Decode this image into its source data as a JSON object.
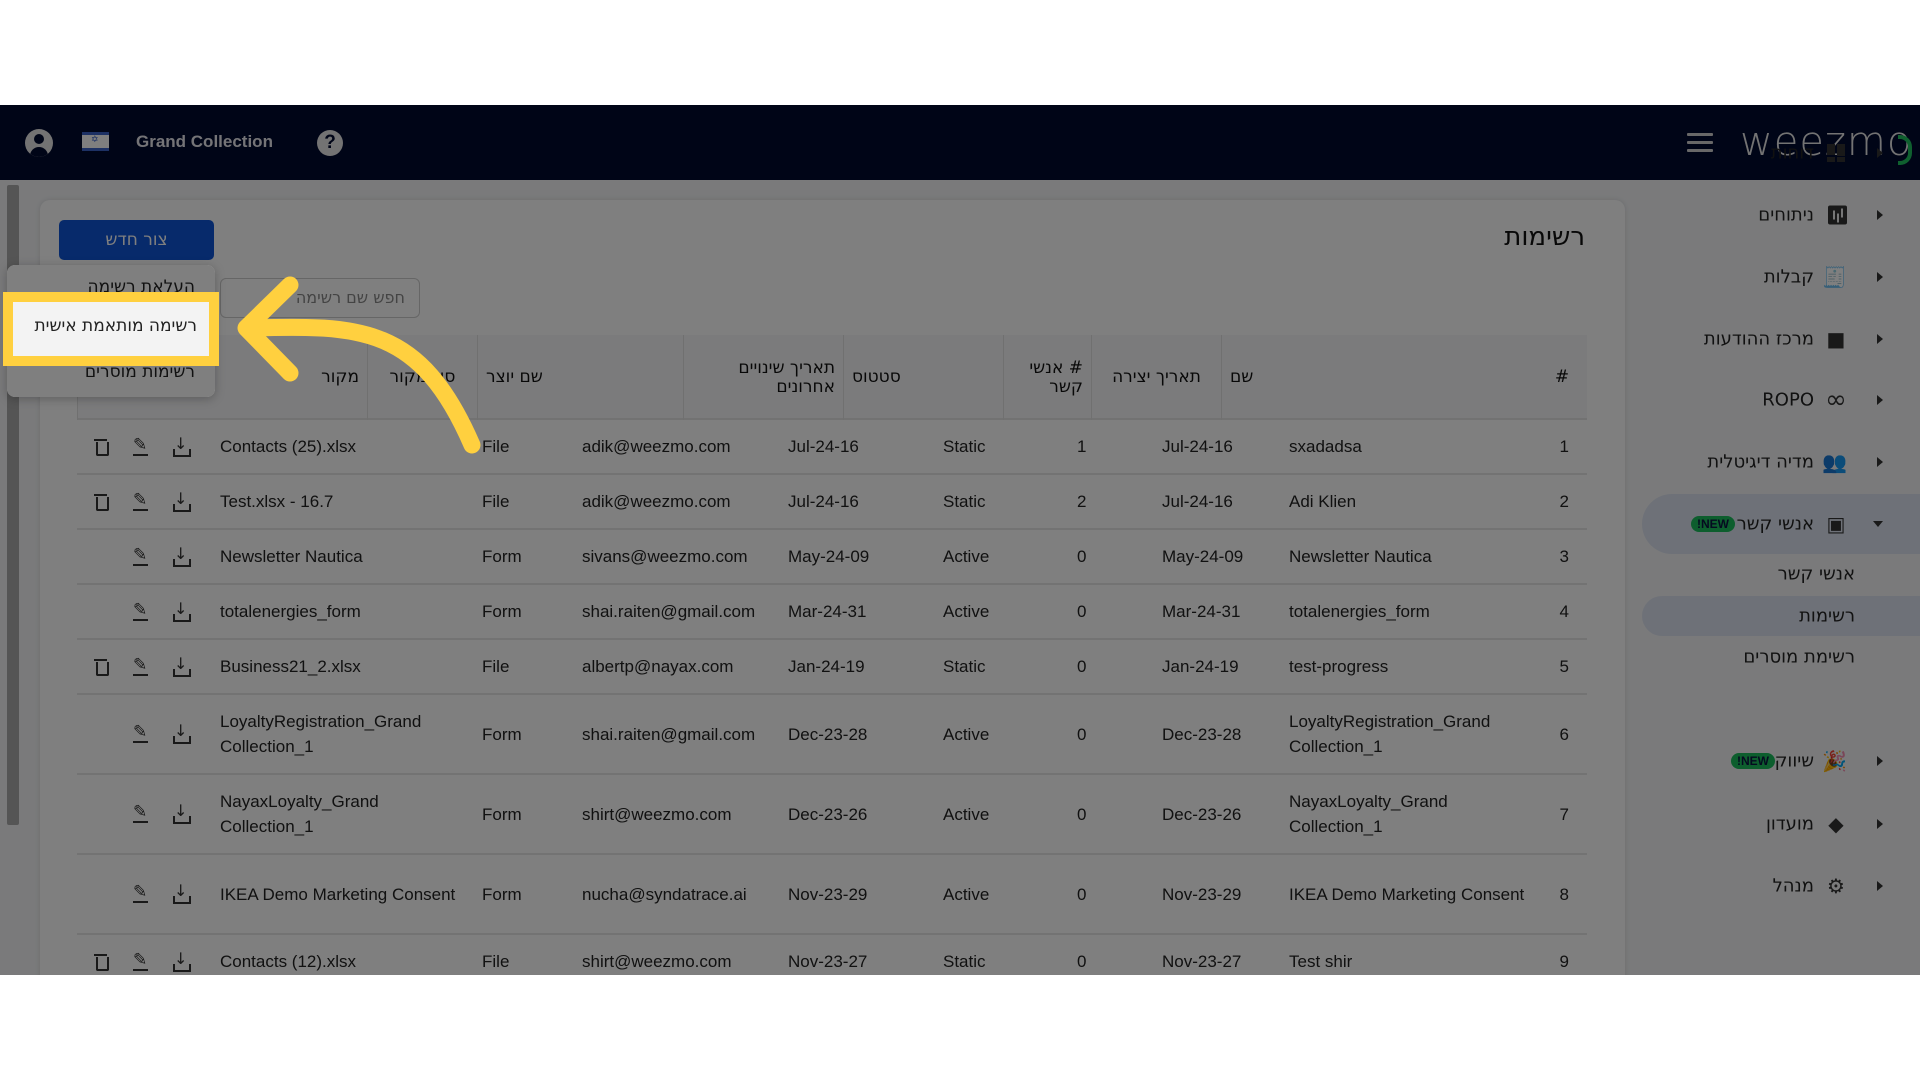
{
  "header": {
    "account_name": "Grand Collection",
    "logo_text": "weezmo",
    "icons": [
      "user-icon",
      "israel-flag-icon",
      "help-icon",
      "menu-icon"
    ]
  },
  "page": {
    "title": "רשימות",
    "create_button": "צור חדש",
    "search_placeholder": "חפש שם רשימה"
  },
  "dropdown": {
    "items": [
      "העלאת רשימה",
      "רשימה מותאמת אישית",
      "רשימות מוסרים"
    ],
    "highlighted_index": 1
  },
  "table": {
    "columns": [
      "#",
      "שם",
      "תאריך יצירה",
      "# אנשי קשר",
      "סטטוס",
      "תאריך שינויים אחרונים",
      "שם יוצר",
      "סוג מקור",
      "מקור"
    ],
    "rows": [
      {
        "num": "1",
        "name": "sxadadsa",
        "created": "Jul-24-16",
        "contacts": "1",
        "status": "Static",
        "modified": "Jul-24-16",
        "creator": "adik@weezmo.com",
        "source_type": "File",
        "source": "Contacts (25).xlsx",
        "deletable": true
      },
      {
        "num": "2",
        "name": "Adi Klien",
        "created": "Jul-24-16",
        "contacts": "2",
        "status": "Static",
        "modified": "Jul-24-16",
        "creator": "adik@weezmo.com",
        "source_type": "File",
        "source": "Test.xlsx - 16.7",
        "deletable": true
      },
      {
        "num": "3",
        "name": "Newsletter Nautica",
        "created": "May-24-09",
        "contacts": "0",
        "status": "Active",
        "modified": "May-24-09",
        "creator": "sivans@weezmo.com",
        "source_type": "Form",
        "source": "Newsletter Nautica",
        "deletable": false
      },
      {
        "num": "4",
        "name": "totalenergies_form",
        "created": "Mar-24-31",
        "contacts": "0",
        "status": "Active",
        "modified": "Mar-24-31",
        "creator": "shai.raiten@gmail.com",
        "source_type": "Form",
        "source": "totalenergies_form",
        "deletable": false
      },
      {
        "num": "5",
        "name": "test-progress",
        "created": "Jan-24-19",
        "contacts": "0",
        "status": "Static",
        "modified": "Jan-24-19",
        "creator": "albertp@nayax.com",
        "source_type": "File",
        "source": "Business21_2.xlsx",
        "deletable": true
      },
      {
        "num": "6",
        "name": "LoyaltyRegistration_Grand Collection_1",
        "created": "Dec-23-28",
        "contacts": "0",
        "status": "Active",
        "modified": "Dec-23-28",
        "creator": "shai.raiten@gmail.com",
        "source_type": "Form",
        "source": "LoyaltyRegistration_Grand Collection_1",
        "deletable": false
      },
      {
        "num": "7",
        "name": "NayaxLoyalty_Grand Collection_1",
        "created": "Dec-23-26",
        "contacts": "0",
        "status": "Active",
        "modified": "Dec-23-26",
        "creator": "shirt@weezmo.com",
        "source_type": "Form",
        "source": "NayaxLoyalty_Grand Collection_1",
        "deletable": false
      },
      {
        "num": "8",
        "name": "IKEA Demo Marketing Consent",
        "created": "Nov-23-29",
        "contacts": "0",
        "status": "Active",
        "modified": "Nov-23-29",
        "creator": "nucha@syndatrace.ai",
        "source_type": "Form",
        "source": "IKEA Demo Marketing Consent",
        "deletable": false
      },
      {
        "num": "9",
        "name": "Test shir",
        "created": "Nov-23-27",
        "contacts": "0",
        "status": "Static",
        "modified": "Nov-23-27",
        "creator": "shirt@weezmo.com",
        "source_type": "File",
        "source": "Contacts (12).xlsx",
        "deletable": true
      }
    ]
  },
  "sidebar": {
    "items": [
      {
        "label": "דוחות",
        "icon": "dashboard-icon"
      },
      {
        "label": "ניתוחים",
        "icon": "analytics-icon"
      },
      {
        "label": "קבלות",
        "icon": "receipt-icon"
      },
      {
        "label": "מרכז ההודעות",
        "icon": "chat-icon"
      },
      {
        "label": "ROPO",
        "icon": "infinity-icon"
      },
      {
        "label": "מדיה דיגיטלית",
        "icon": "people-icon"
      },
      {
        "label": "אנשי קשר",
        "icon": "contacts-icon",
        "badge": "NEW!",
        "open": true
      },
      {
        "label": "שיווק",
        "icon": "party-popper-icon",
        "badge": "NEW!"
      },
      {
        "label": "מועדון",
        "icon": "tag-heart-icon"
      },
      {
        "label": "מנהל",
        "icon": "gear-icon"
      }
    ],
    "sub_items": [
      {
        "label": "אנשי קשר",
        "active": false
      },
      {
        "label": "רשימות",
        "active": true
      },
      {
        "label": "רשימת מוסרים",
        "active": false
      }
    ]
  },
  "colors": {
    "topbar": "#000a2e",
    "primary_button": "#0e55d6",
    "new_badge": "#1bbd5c",
    "highlight": "#ffd03f",
    "logo_accent": "#1fc15f"
  }
}
